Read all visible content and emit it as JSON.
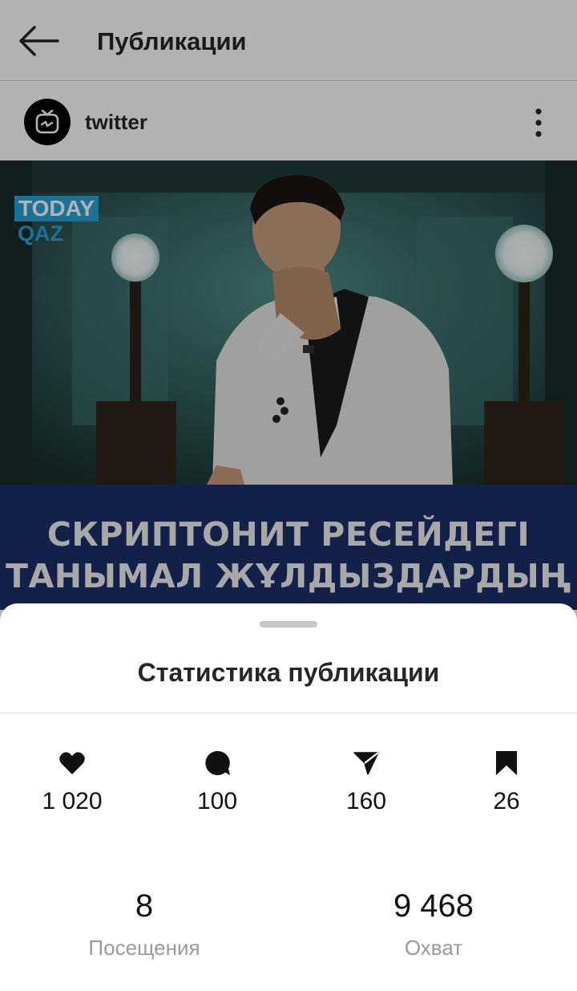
{
  "header": {
    "title": "Публикации"
  },
  "post": {
    "username": "twitter",
    "logo": {
      "line1": "TODAY",
      "line2": "QAZ"
    },
    "caption_lines": [
      "СКРИПТОНИТ РЕСЕЙДЕГІ",
      "ТАНЫМАЛ ЖҰЛДЫЗДАРДЫҢ"
    ]
  },
  "sheet": {
    "title": "Статистика публикации",
    "stats": [
      {
        "icon": "heart-icon",
        "value": "1 020"
      },
      {
        "icon": "comment-icon",
        "value": "100"
      },
      {
        "icon": "send-icon",
        "value": "160"
      },
      {
        "icon": "bookmark-icon",
        "value": "26"
      }
    ],
    "summary": [
      {
        "value": "8",
        "label": "Посещения"
      },
      {
        "value": "9 468",
        "label": "Охват"
      }
    ]
  },
  "colors": {
    "caption_band": "#1b2f6b",
    "logo_blue": "#2aa3d6",
    "muted_label": "#9a9a9a"
  }
}
